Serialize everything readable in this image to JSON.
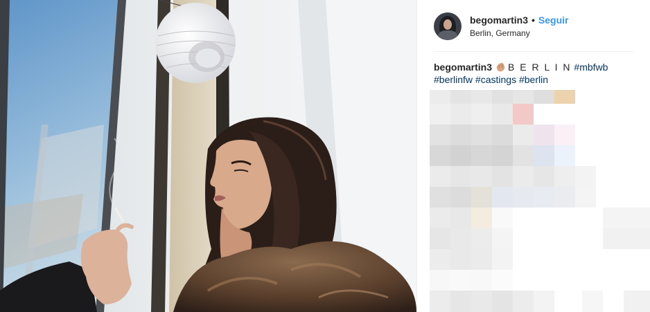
{
  "post": {
    "username": "begomartin3",
    "separator": "•",
    "follow_label": "Seguir",
    "location": "Berlin, Germany",
    "avatar": "profile-avatar"
  },
  "caption": {
    "username": "begomartin3",
    "emoji": "waving-hand-icon",
    "text": "B E R L I N",
    "hashtags": [
      "#mbfwb",
      "#berlinfw",
      "#castings",
      "#berlin"
    ]
  },
  "colors": {
    "follow": "#3897f0",
    "hashtag": "#003569",
    "text": "#262626",
    "divider": "#efefef"
  }
}
